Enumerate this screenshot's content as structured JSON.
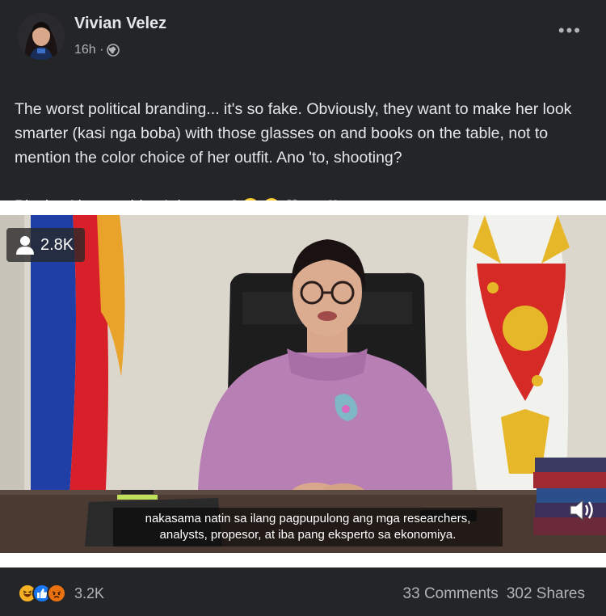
{
  "post": {
    "author": "Vivian Velez",
    "time": "16h ·",
    "privacy_icon": "globe-icon",
    "text_line1": "The worst political branding... it's so fake.  Obviously, they want to make her look smarter (kasi nga boba) with those glasses on and books on the table, not to mention the color choice of her outfit. Ano 'to, shooting?",
    "text_line2": "Playing 'the president' daw sya?",
    "emojis": [
      "laughing-emoji",
      "rofl-emoji",
      "film-projector-emoji",
      "clapper-board-emoji",
      "movie-camera-emoji"
    ]
  },
  "video": {
    "viewer_count": "2.8K",
    "subtitle_line1": "nakasama natin sa ilang pagpupulong ang mga researchers,",
    "subtitle_line2": "analysts, propesor, at iba pang eksperto sa ekonomiya."
  },
  "footer": {
    "reactions": [
      "haha-icon",
      "like-icon",
      "angry-icon"
    ],
    "reaction_count": "3.2K",
    "comments": "33 Comments",
    "shares": "302 Shares"
  },
  "colors": {
    "background": "#242526",
    "text": "#e4e6eb",
    "muted": "#b0b3b8",
    "like_blue": "#1877f2",
    "haha_yellow": "#f7b125",
    "angry_orange": "#e9710f"
  }
}
